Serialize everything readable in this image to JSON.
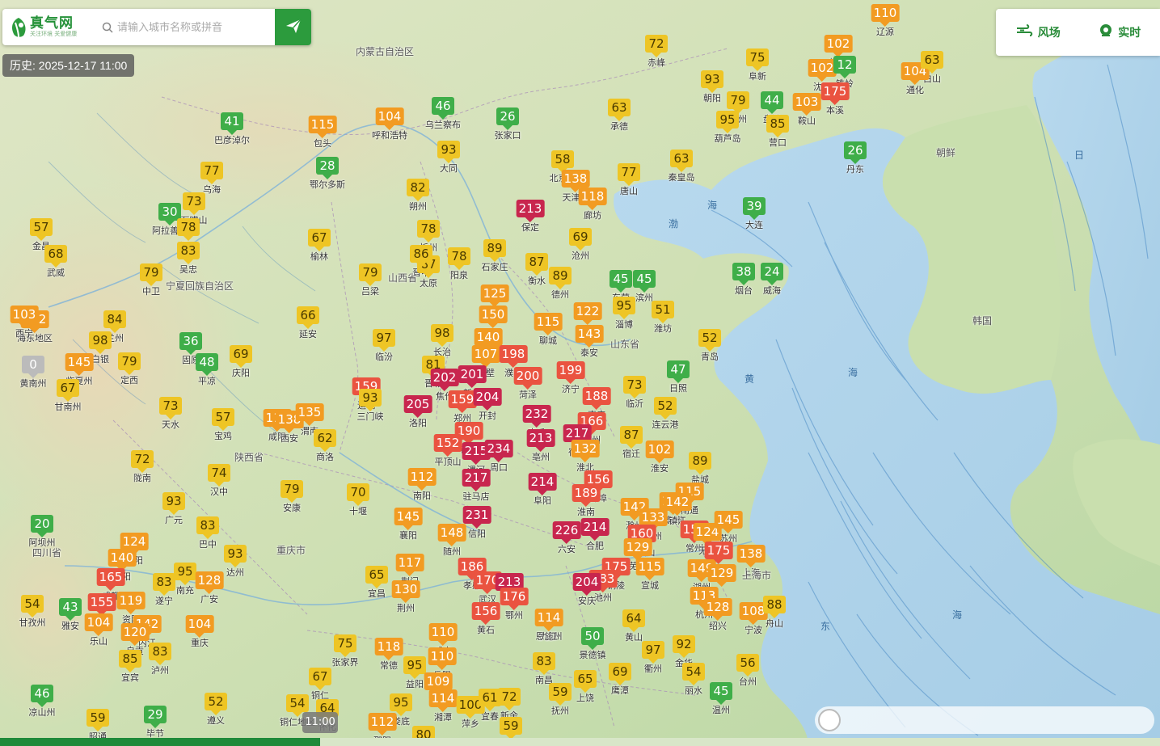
{
  "search": {
    "logo_title": "真气网",
    "logo_slogan": "关注环境 关爱健康",
    "placeholder": "请输入城市名称或拼音"
  },
  "history_label": "历史: 2025-12-17 11:00",
  "modes": {
    "wind_label": "风场",
    "realtime_label": "实时"
  },
  "timeline": {
    "current_time": "11:00",
    "progress": 0.276
  },
  "colors": {
    "good": "#3fae49",
    "moderate": "#eec525",
    "light": "#f29b22",
    "moderate_pollution": "#ea5340",
    "heavy": "#c8264e",
    "none": "#bbbbbb"
  },
  "provinces": [
    {
      "name": "内蒙古自治区"
    },
    {
      "name": "山西省"
    },
    {
      "name": "陕西省"
    },
    {
      "name": "山东省"
    },
    {
      "name": "重庆市"
    },
    {
      "name": "上海市"
    },
    {
      "name": "四川省"
    },
    {
      "name": "朝鲜"
    },
    {
      "name": "韩国"
    },
    {
      "name": "宁夏回族自治区"
    }
  ],
  "seas": [
    {
      "name": "渤"
    },
    {
      "name": "海"
    },
    {
      "name": "黄"
    },
    {
      "name": "海"
    },
    {
      "name": "东"
    },
    {
      "name": "海"
    },
    {
      "name": "日"
    }
  ],
  "cities": [
    {
      "name": "巴彦淖尔",
      "aqi": 41
    },
    {
      "name": "包头",
      "aqi": 115
    },
    {
      "name": "呼和浩特",
      "aqi": 104
    },
    {
      "name": "乌兰察布",
      "aqi": 46
    },
    {
      "name": "张家口",
      "aqi": 26
    },
    {
      "name": "赤峰",
      "aqi": 72
    },
    {
      "name": "阜新",
      "aqi": 75
    },
    {
      "name": "朝阳",
      "aqi": 93
    },
    {
      "name": "承德",
      "aqi": 63
    },
    {
      "name": "鄂尔多斯",
      "aqi": 28
    },
    {
      "name": "大同",
      "aqi": 93
    },
    {
      "name": "北京市",
      "aqi": 58
    },
    {
      "name": "天津市",
      "aqi": 138
    },
    {
      "name": "唐山",
      "aqi": 77
    },
    {
      "name": "秦皇岛",
      "aqi": 63
    },
    {
      "name": "葫芦岛",
      "aqi": 95
    },
    {
      "name": "锦州",
      "aqi": 79
    },
    {
      "name": "盘锦",
      "aqi": 44
    },
    {
      "name": "营口",
      "aqi": 85
    },
    {
      "name": "鞍山",
      "aqi": 103
    },
    {
      "name": "本溪",
      "aqi": 175
    },
    {
      "name": "丹东",
      "aqi": 26
    },
    {
      "name": "通化",
      "aqi": 104
    },
    {
      "name": "白山",
      "aqi": 63
    },
    {
      "name": "辽源",
      "aqi": 110
    },
    {
      "name": "抚顺",
      "aqi": 102
    },
    {
      "name": "沈阳",
      "aqi": 102
    },
    {
      "name": "铁岭",
      "aqi": 12
    },
    {
      "name": "大连",
      "aqi": 39
    },
    {
      "name": "乌海",
      "aqi": 77
    },
    {
      "name": "石嘴山",
      "aqi": 73
    },
    {
      "name": "阿拉善盟",
      "aqi": 30
    },
    {
      "name": "银川",
      "aqi": 78
    },
    {
      "name": "吴忠",
      "aqi": 83
    },
    {
      "name": "中卫",
      "aqi": 79
    },
    {
      "name": "武威",
      "aqi": 68
    },
    {
      "name": "金昌",
      "aqi": 57
    },
    {
      "name": "朔州",
      "aqi": 82
    },
    {
      "name": "保定",
      "aqi": 213
    },
    {
      "name": "廊坊",
      "aqi": 118
    },
    {
      "name": "榆林",
      "aqi": 67
    },
    {
      "name": "忻州",
      "aqi": 78
    },
    {
      "name": "沧州",
      "aqi": 69
    },
    {
      "name": "石家庄",
      "aqi": 89
    },
    {
      "name": "太原",
      "aqi": 87
    },
    {
      "name": "吕梁",
      "aqi": 79
    },
    {
      "name": "阳泉",
      "aqi": 78
    },
    {
      "name": "晋中",
      "aqi": 86
    },
    {
      "name": "衡水",
      "aqi": 87
    },
    {
      "name": "德州",
      "aqi": 89
    },
    {
      "name": "烟台",
      "aqi": 38
    },
    {
      "name": "威海",
      "aqi": 24
    },
    {
      "name": "东营",
      "aqi": 45
    },
    {
      "name": "滨州",
      "aqi": 45
    },
    {
      "name": "淄博",
      "aqi": 95
    },
    {
      "name": "潍坊",
      "aqi": 51
    },
    {
      "name": "青岛",
      "aqi": 52
    },
    {
      "name": "邢台",
      "aqi": 125
    },
    {
      "name": "邯郸",
      "aqi": 150
    },
    {
      "name": "济南",
      "aqi": 122
    },
    {
      "name": "聊城",
      "aqi": 115
    },
    {
      "name": "泰安",
      "aqi": 143
    },
    {
      "name": "安阳",
      "aqi": 140
    },
    {
      "name": "鹤壁",
      "aqi": 107
    },
    {
      "name": "濮阳",
      "aqi": 198
    },
    {
      "name": "海东地区",
      "aqi": 102
    },
    {
      "name": "西宁",
      "aqi": 103
    },
    {
      "name": "兰州",
      "aqi": 84
    },
    {
      "name": "白银",
      "aqi": 98
    },
    {
      "name": "延安",
      "aqi": 66
    },
    {
      "name": "临汾",
      "aqi": 97
    },
    {
      "name": "长治",
      "aqi": 98
    },
    {
      "name": "黄南州",
      "aqi": 0
    },
    {
      "name": "定西",
      "aqi": 79
    },
    {
      "name": "甘南州",
      "aqi": 67
    },
    {
      "name": "临夏州",
      "aqi": 145
    },
    {
      "name": "固原",
      "aqi": 36
    },
    {
      "name": "平凉",
      "aqi": 48
    },
    {
      "name": "庆阳",
      "aqi": 69
    },
    {
      "name": "晋城",
      "aqi": 81
    },
    {
      "name": "焦作",
      "aqi": 202
    },
    {
      "name": "新乡",
      "aqi": 201
    },
    {
      "name": "菏泽",
      "aqi": 200
    },
    {
      "name": "济宁",
      "aqi": 199
    },
    {
      "name": "日照",
      "aqi": 47
    },
    {
      "name": "运城",
      "aqi": 159
    },
    {
      "name": "三门峡",
      "aqi": 93
    },
    {
      "name": "洛阳",
      "aqi": 205
    },
    {
      "name": "郑州",
      "aqi": 159
    },
    {
      "name": "开封",
      "aqi": 204
    },
    {
      "name": "临沂",
      "aqi": 73
    },
    {
      "name": "枣庄",
      "aqi": 188
    },
    {
      "name": "商丘",
      "aqi": 232
    },
    {
      "name": "徐州",
      "aqi": 166
    },
    {
      "name": "连云港",
      "aqi": 52
    },
    {
      "name": "天水",
      "aqi": 73
    },
    {
      "name": "宝鸡",
      "aqi": 57
    },
    {
      "name": "咸阳",
      "aqi": 110
    },
    {
      "name": "西安",
      "aqi": 138
    },
    {
      "name": "渭南",
      "aqi": 135
    },
    {
      "name": "商洛",
      "aqi": 62
    },
    {
      "name": "许昌",
      "aqi": 190
    },
    {
      "name": "亳州",
      "aqi": 213
    },
    {
      "name": "宿州",
      "aqi": 217
    },
    {
      "name": "宿迁",
      "aqi": 87
    },
    {
      "name": "平顶山",
      "aqi": 152
    },
    {
      "name": "漯河",
      "aqi": 215
    },
    {
      "name": "周口",
      "aqi": 234
    },
    {
      "name": "淮北",
      "aqi": 132
    },
    {
      "name": "淮安",
      "aqi": 102
    },
    {
      "name": "陇南",
      "aqi": 72
    },
    {
      "name": "汉中",
      "aqi": 74
    },
    {
      "name": "南阳",
      "aqi": 112
    },
    {
      "name": "驻马店",
      "aqi": 217
    },
    {
      "name": "阜阳",
      "aqi": 214
    },
    {
      "name": "蚌埠",
      "aqi": 156
    },
    {
      "name": "盐城",
      "aqi": 89
    },
    {
      "name": "广元",
      "aqi": 93
    },
    {
      "name": "安康",
      "aqi": 79
    },
    {
      "name": "十堰",
      "aqi": 70
    },
    {
      "name": "淮南",
      "aqi": 189
    },
    {
      "name": "滁州",
      "aqi": 142
    },
    {
      "name": "扬州",
      "aqi": 133
    },
    {
      "name": "泰州",
      "aqi": 124
    },
    {
      "name": "南通",
      "aqi": 115
    },
    {
      "name": "阿坝州",
      "aqi": 20
    },
    {
      "name": "巴中",
      "aqi": 83
    },
    {
      "name": "襄阳",
      "aqi": 145
    },
    {
      "name": "信阳",
      "aqi": 231
    },
    {
      "name": "随州",
      "aqi": 148
    },
    {
      "name": "六安",
      "aqi": 226
    },
    {
      "name": "合肥",
      "aqi": 214
    },
    {
      "name": "马鞍山",
      "aqi": 160
    },
    {
      "name": "镇江",
      "aqi": 142
    },
    {
      "name": "常州",
      "aqi": 152
    },
    {
      "name": "无锡",
      "aqi": 124
    },
    {
      "name": "苏州",
      "aqi": 145
    },
    {
      "name": "德阳",
      "aqi": 124
    },
    {
      "name": "绵阳",
      "aqi": 140
    },
    {
      "name": "南充",
      "aqi": 95
    },
    {
      "name": "达州",
      "aqi": 93
    },
    {
      "name": "芜湖",
      "aqi": 129
    },
    {
      "name": "宣城",
      "aqi": 115
    },
    {
      "name": "湖州",
      "aqi": 149
    },
    {
      "name": "嘉兴",
      "aqi": 175
    },
    {
      "name": "上海",
      "aqi": 138
    },
    {
      "name": "成都",
      "aqi": 165
    },
    {
      "name": "遂宁",
      "aqi": 83
    },
    {
      "name": "广安",
      "aqi": 128
    },
    {
      "name": "宜昌",
      "aqi": 65
    },
    {
      "name": "荆门",
      "aqi": 117
    },
    {
      "name": "孝感",
      "aqi": 186
    },
    {
      "name": "武汉",
      "aqi": 170
    },
    {
      "name": "黄冈",
      "aqi": 213
    },
    {
      "name": "鄂州",
      "aqi": 176
    },
    {
      "name": "铜陵",
      "aqi": 175
    },
    {
      "name": "池州",
      "aqi": 183
    },
    {
      "name": "安庆",
      "aqi": 204
    },
    {
      "name": "杭州",
      "aqi": 113
    },
    {
      "name": "绍兴",
      "aqi": 128
    },
    {
      "name": "宁波",
      "aqi": 108
    },
    {
      "name": "舟山",
      "aqi": 88
    },
    {
      "name": "129",
      "aqi": 129
    },
    {
      "name": "眉山",
      "aqi": 155
    },
    {
      "name": "资阳",
      "aqi": 119
    },
    {
      "name": "内江",
      "aqi": 142
    },
    {
      "name": "荆州",
      "aqi": 130
    },
    {
      "name": "黄石",
      "aqi": 156
    },
    {
      "name": "恩施州",
      "aqi": 84
    },
    {
      "name": "甘孜州",
      "aqi": 54
    },
    {
      "name": "雅安",
      "aqi": 43
    },
    {
      "name": "乐山",
      "aqi": 104
    },
    {
      "name": "自贡",
      "aqi": 120
    },
    {
      "name": "重庆",
      "aqi": 104
    },
    {
      "name": "咸宁",
      "aqi": 110
    },
    {
      "name": "九江",
      "aqi": 114
    },
    {
      "name": "景德镇",
      "aqi": 50
    },
    {
      "name": "黄山",
      "aqi": 64
    },
    {
      "name": "衢州",
      "aqi": 97
    },
    {
      "name": "金华",
      "aqi": 92
    },
    {
      "name": "宜宾",
      "aqi": 85
    },
    {
      "name": "泸州",
      "aqi": 83
    },
    {
      "name": "张家界",
      "aqi": 75
    },
    {
      "name": "常德",
      "aqi": 118
    },
    {
      "name": "岳阳",
      "aqi": 110
    },
    {
      "name": "益阳",
      "aqi": 95
    },
    {
      "name": "南昌",
      "aqi": 83
    },
    {
      "name": "上饶",
      "aqi": 65
    },
    {
      "name": "鹰潭",
      "aqi": 69
    },
    {
      "name": "丽水",
      "aqi": 54
    },
    {
      "name": "台州",
      "aqi": 56
    },
    {
      "name": "温州",
      "aqi": 45
    },
    {
      "name": "铜仁",
      "aqi": 67
    },
    {
      "name": "长沙",
      "aqi": 109
    },
    {
      "name": "湘潭",
      "aqi": 114
    },
    {
      "name": "萍乡",
      "aqi": 100
    },
    {
      "name": "宜春",
      "aqi": 61
    },
    {
      "name": "新余",
      "aqi": 72
    },
    {
      "name": "抚州",
      "aqi": 59
    },
    {
      "name": "凉山州",
      "aqi": 46
    },
    {
      "name": "遵义",
      "aqi": 52
    },
    {
      "name": "昭通",
      "aqi": 59
    },
    {
      "name": "毕节",
      "aqi": 29
    },
    {
      "name": "铜仁地区",
      "aqi": 54
    },
    {
      "name": "怀化",
      "aqi": 64
    },
    {
      "name": "娄底",
      "aqi": 95
    },
    {
      "name": "邵阳",
      "aqi": 112
    },
    {
      "name": "株洲",
      "aqi": 80
    },
    {
      "name": "吉安",
      "aqi": 59
    }
  ]
}
